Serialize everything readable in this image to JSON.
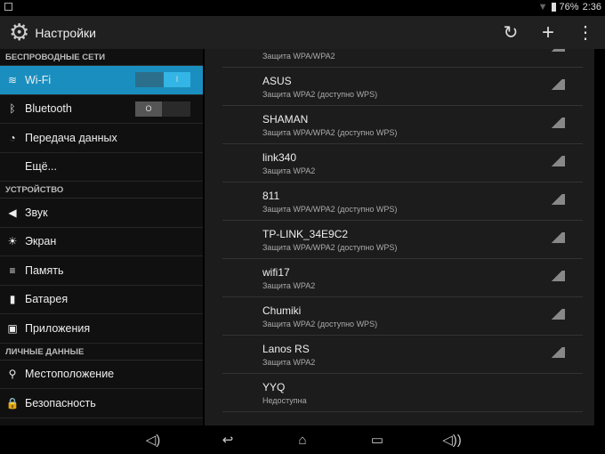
{
  "status": {
    "battery": "76%",
    "time": "2:36",
    "icons": [
      "image-icon",
      "wifi-icon",
      "battery-icon"
    ]
  },
  "action": {
    "title": "Настройки",
    "icons": [
      "settings-gear-icon",
      "wps-icon",
      "add-icon",
      "overflow-menu-icon"
    ]
  },
  "accent": "#1a8fbf",
  "sidebar": {
    "headers": [
      "БЕСПРОВОДНЫЕ СЕТИ",
      "УСТРОЙСТВО",
      "ЛИЧНЫЕ ДАННЫЕ"
    ],
    "items": [
      {
        "label": "Wi-Fi",
        "icon": "wifi-icon",
        "toggle": "I",
        "on": true
      },
      {
        "label": "Bluetooth",
        "icon": "bluetooth-icon",
        "toggle": "O",
        "on": false
      },
      {
        "label": "Передача данных",
        "icon": "data-usage-icon"
      },
      {
        "label": "Ещё...",
        "icon": ""
      },
      {
        "label": "Звук",
        "icon": "sound-icon"
      },
      {
        "label": "Экран",
        "icon": "display-icon"
      },
      {
        "label": "Память",
        "icon": "storage-icon"
      },
      {
        "label": "Батарея",
        "icon": "battery-icon"
      },
      {
        "label": "Приложения",
        "icon": "apps-icon"
      },
      {
        "label": "Местоположение",
        "icon": "location-icon"
      },
      {
        "label": "Безопасность",
        "icon": "lock-icon"
      }
    ]
  },
  "networks": [
    {
      "name": "",
      "security": "Защита WPA/WPA2"
    },
    {
      "name": "ASUS",
      "security": "Защита WPA2 (доступно WPS)"
    },
    {
      "name": "SHAMAN",
      "security": "Защита WPA/WPA2 (доступно WPS)"
    },
    {
      "name": "link340",
      "security": "Защита WPA2"
    },
    {
      "name": "811",
      "security": "Защита WPA/WPA2 (доступно WPS)"
    },
    {
      "name": "TP-LINK_34E9C2",
      "security": "Защита WPA/WPA2 (доступно WPS)"
    },
    {
      "name": "wifi17",
      "security": "Защита WPA2"
    },
    {
      "name": "Chumiki",
      "security": "Защита WPA2 (доступно WPS)"
    },
    {
      "name": "Lanos RS",
      "security": "Защита WPA2"
    },
    {
      "name": "YYQ",
      "security": "Недоступна"
    }
  ],
  "navbar": [
    "volume-down-icon",
    "back-icon",
    "home-icon",
    "recent-apps-icon",
    "volume-up-icon"
  ]
}
